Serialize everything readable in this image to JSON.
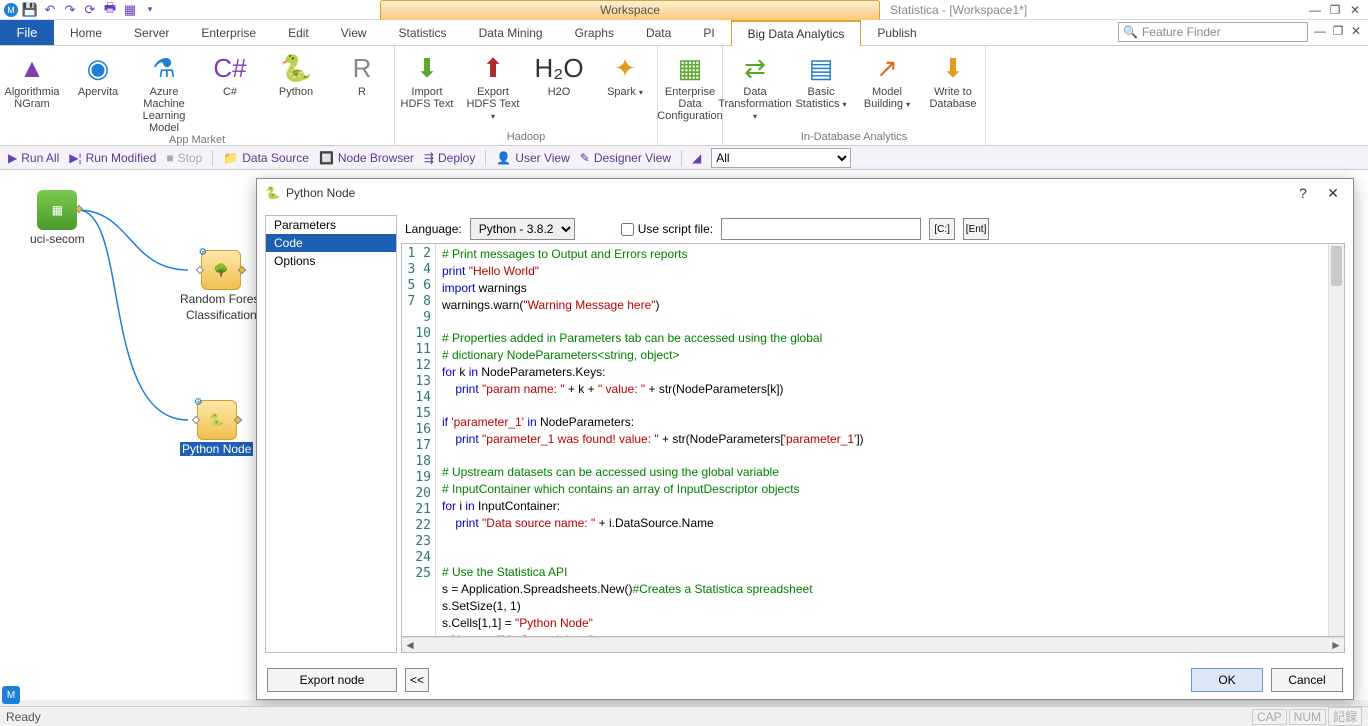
{
  "title": {
    "workspace": "Workspace",
    "app": "Statistica - [Workspace1*]"
  },
  "qat_icons": [
    "app",
    "save",
    "undo",
    "redo",
    "refresh",
    "print",
    "grid",
    "dropdown"
  ],
  "tabs": {
    "file": "File",
    "list": [
      "Home",
      "Server",
      "Enterprise",
      "Edit",
      "View",
      "Statistics",
      "Data Mining",
      "Graphs",
      "Data",
      "PI",
      "Big Data Analytics",
      "Publish"
    ],
    "active_index": 10
  },
  "feature_finder_placeholder": "Feature Finder",
  "ribbon": {
    "groups": [
      {
        "label": "App Market",
        "items": [
          {
            "name": "algorithmia-ngram",
            "label": "Algorithmia\nNGram",
            "color": "#7a3fb0",
            "glyph": "▲"
          },
          {
            "name": "apervita",
            "label": "Apervita",
            "color": "#1e7fd6",
            "glyph": "◉"
          },
          {
            "name": "azure-ml",
            "label": "Azure Machine\nLearning Model",
            "color": "#1e7fd6",
            "glyph": "⚗"
          },
          {
            "name": "csharp",
            "label": "C#",
            "color": "#7a3fb0",
            "glyph": "C#"
          },
          {
            "name": "python",
            "label": "Python",
            "color": "#3776ab",
            "glyph": "🐍"
          },
          {
            "name": "r",
            "label": "R",
            "color": "#888",
            "glyph": "R"
          }
        ]
      },
      {
        "label": "Hadoop",
        "items": [
          {
            "name": "import-hdfs",
            "label": "Import\nHDFS Text",
            "color": "#5aa52b",
            "glyph": "⬇"
          },
          {
            "name": "export-hdfs",
            "label": "Export\nHDFS Text",
            "color": "#b02a2a",
            "glyph": "⬆",
            "drop": true
          },
          {
            "name": "h2o",
            "label": "H2O",
            "color": "#333",
            "glyph": "H₂O"
          },
          {
            "name": "spark",
            "label": "Spark",
            "color": "#e29b1e",
            "glyph": "✦",
            "drop": true
          }
        ]
      },
      {
        "label": "",
        "items": [
          {
            "name": "enterprise-data-config",
            "label": "Enterprise Data\nConfiguration",
            "color": "#5aa52b",
            "glyph": "▦"
          }
        ]
      },
      {
        "label": "In-Database Analytics",
        "items": [
          {
            "name": "data-transformation",
            "label": "Data\nTransformation",
            "color": "#5aa52b",
            "glyph": "⇄",
            "drop": true
          },
          {
            "name": "basic-statistics",
            "label": "Basic\nStatistics",
            "color": "#1e7fd6",
            "glyph": "▤",
            "drop": true
          },
          {
            "name": "model-building",
            "label": "Model\nBuilding",
            "color": "#e06a1e",
            "glyph": "↗",
            "drop": true
          },
          {
            "name": "write-to-db",
            "label": "Write to\nDatabase",
            "color": "#e29b1e",
            "glyph": "⬇"
          }
        ]
      }
    ]
  },
  "actionbar": {
    "run_all": "Run All",
    "run_modified": "Run Modified",
    "stop": "Stop",
    "data_source": "Data Source",
    "node_browser": "Node Browser",
    "deploy": "Deploy",
    "user_view": "User View",
    "designer_view": "Designer View",
    "filter_value": "All"
  },
  "canvas": {
    "nodes": {
      "data": {
        "label": "uci-secom"
      },
      "rf": {
        "label1": "Random Forest",
        "label2": "Classification"
      },
      "py": {
        "label": "Python Node"
      }
    }
  },
  "dialog": {
    "title": "Python Node",
    "nav": {
      "parameters": "Parameters",
      "code": "Code",
      "options": "Options",
      "selected": "code"
    },
    "lang_label": "Language:",
    "lang_value": "Python - 3.8.2",
    "use_script": "Use script file:",
    "c_btn": "[C:]",
    "ent_btn": "[Ent]",
    "code_lines": [
      {
        "n": 1,
        "t": [
          [
            "c",
            "# Print messages to Output and Errors reports"
          ]
        ]
      },
      {
        "n": 2,
        "t": [
          [
            "k",
            "print"
          ],
          [
            "n",
            " "
          ],
          [
            "s",
            "\"Hello World\""
          ]
        ]
      },
      {
        "n": 3,
        "t": [
          [
            "k",
            "import"
          ],
          [
            "n",
            " warnings"
          ]
        ]
      },
      {
        "n": 4,
        "t": [
          [
            "n",
            "warnings.warn("
          ],
          [
            "s",
            "\"Warning Message here\""
          ],
          [
            "n",
            ")"
          ]
        ]
      },
      {
        "n": 5,
        "t": []
      },
      {
        "n": 6,
        "t": [
          [
            "c",
            "# Properties added in Parameters tab can be accessed using the global"
          ]
        ]
      },
      {
        "n": 7,
        "t": [
          [
            "c",
            "# dictionary NodeParameters<string, object>"
          ]
        ]
      },
      {
        "n": 8,
        "t": [
          [
            "k",
            "for"
          ],
          [
            "n",
            " k "
          ],
          [
            "k",
            "in"
          ],
          [
            "n",
            " NodeParameters.Keys:"
          ]
        ]
      },
      {
        "n": 9,
        "t": [
          [
            "n",
            "    "
          ],
          [
            "k",
            "print"
          ],
          [
            "n",
            " "
          ],
          [
            "s",
            "\"param name: \""
          ],
          [
            "n",
            " + k + "
          ],
          [
            "s",
            "\" value: \""
          ],
          [
            "n",
            " + str(NodeParameters[k])"
          ]
        ]
      },
      {
        "n": 10,
        "t": []
      },
      {
        "n": 11,
        "t": [
          [
            "k",
            "if"
          ],
          [
            "n",
            " "
          ],
          [
            "s",
            "'parameter_1'"
          ],
          [
            "n",
            " "
          ],
          [
            "k",
            "in"
          ],
          [
            "n",
            " NodeParameters:"
          ]
        ]
      },
      {
        "n": 12,
        "t": [
          [
            "n",
            "    "
          ],
          [
            "k",
            "print"
          ],
          [
            "n",
            " "
          ],
          [
            "s",
            "\"parameter_1 was found! value: \""
          ],
          [
            "n",
            " + str(NodeParameters["
          ],
          [
            "s",
            "'parameter_1'"
          ],
          [
            "n",
            "])"
          ]
        ]
      },
      {
        "n": 13,
        "t": []
      },
      {
        "n": 14,
        "t": [
          [
            "c",
            "# Upstream datasets can be accessed using the global variable"
          ]
        ]
      },
      {
        "n": 15,
        "t": [
          [
            "c",
            "# InputContainer which contains an array of InputDescriptor objects"
          ]
        ]
      },
      {
        "n": 16,
        "t": [
          [
            "k",
            "for"
          ],
          [
            "n",
            " i "
          ],
          [
            "k",
            "in"
          ],
          [
            "n",
            " InputContainer:"
          ]
        ]
      },
      {
        "n": 17,
        "t": [
          [
            "n",
            "    "
          ],
          [
            "k",
            "print"
          ],
          [
            "n",
            " "
          ],
          [
            "s",
            "\"Data source name: \""
          ],
          [
            "n",
            " + i.DataSource.Name"
          ]
        ]
      },
      {
        "n": 18,
        "t": []
      },
      {
        "n": 19,
        "t": []
      },
      {
        "n": 20,
        "t": [
          [
            "c",
            "# Use the Statistica API"
          ]
        ]
      },
      {
        "n": 21,
        "t": [
          [
            "n",
            "s = Application.Spreadsheets.New()"
          ],
          [
            "c",
            "#Creates a Statistica spreadsheet"
          ]
        ]
      },
      {
        "n": 22,
        "t": [
          [
            "n",
            "s.SetSize(1, 1)"
          ]
        ]
      },
      {
        "n": 23,
        "t": [
          [
            "n",
            "s.Cells[1,1] = "
          ],
          [
            "s",
            "\"Python Node\""
          ]
        ]
      },
      {
        "n": 24,
        "t": [
          [
            "n",
            "s.Name = "
          ],
          [
            "s",
            "\"My Spreadsheet\""
          ]
        ]
      },
      {
        "n": 25,
        "t": []
      }
    ],
    "export_node": "Export node",
    "back": "<<",
    "ok": "OK",
    "cancel": "Cancel"
  },
  "status": {
    "ready": "Ready",
    "cap": "CAP",
    "num": "NUM",
    "rec": "記録"
  }
}
